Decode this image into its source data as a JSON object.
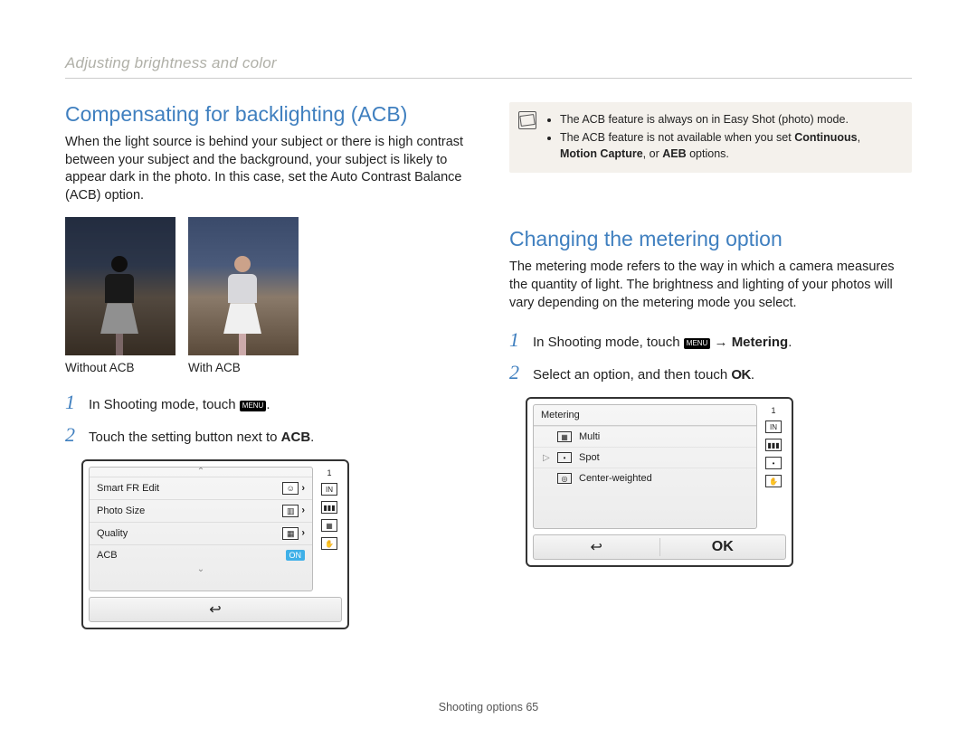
{
  "breadcrumb": "Adjusting brightness and color",
  "left": {
    "heading": "Compensating for backlighting (ACB)",
    "body": "When the light source is behind your subject or there is high contrast between your subject and the background, your subject is likely to appear dark in the photo. In this case, set the Auto Contrast Balance (ACB) option.",
    "photo_without": "Without ACB",
    "photo_with": "With ACB",
    "step1_a": "In Shooting mode, touch ",
    "step1_b": ".",
    "step2_a": "Touch the setting button next to ",
    "step2_bold": "ACB",
    "step2_b": ".",
    "lcd": {
      "rows": [
        {
          "label": "Smart FR Edit"
        },
        {
          "label": "Photo Size"
        },
        {
          "label": "Quality"
        },
        {
          "label": "ACB"
        }
      ],
      "on": "ON",
      "counter": "1"
    }
  },
  "right": {
    "note_line1": "The ACB feature is always on in Easy Shot (photo) mode.",
    "note_line2_a": "The ACB feature is not available when you set ",
    "note_bold1": "Continuous",
    "note_sep": ", ",
    "note_bold2": "Motion Capture",
    "note_sep2": ", or ",
    "note_bold3": "AEB",
    "note_line2_b": " options.",
    "heading": "Changing the metering option",
    "body": "The metering mode refers to the way in which a camera measures the quantity of light. The brightness and lighting of your photos will vary depending on the metering mode you select.",
    "step1_a": "In Shooting mode, touch ",
    "step1_arrow": " → ",
    "step1_bold": "Metering",
    "step1_b": ".",
    "step2_a": "Select an option, and then touch ",
    "step2_b": ".",
    "lcd": {
      "title": "Metering",
      "options": [
        "Multi",
        "Spot",
        "Center-weighted"
      ],
      "ok": "OK",
      "counter": "1"
    }
  },
  "menu_chip": "MENU",
  "ok_chip": "OK",
  "footer_a": "Shooting options  ",
  "footer_page": "65"
}
